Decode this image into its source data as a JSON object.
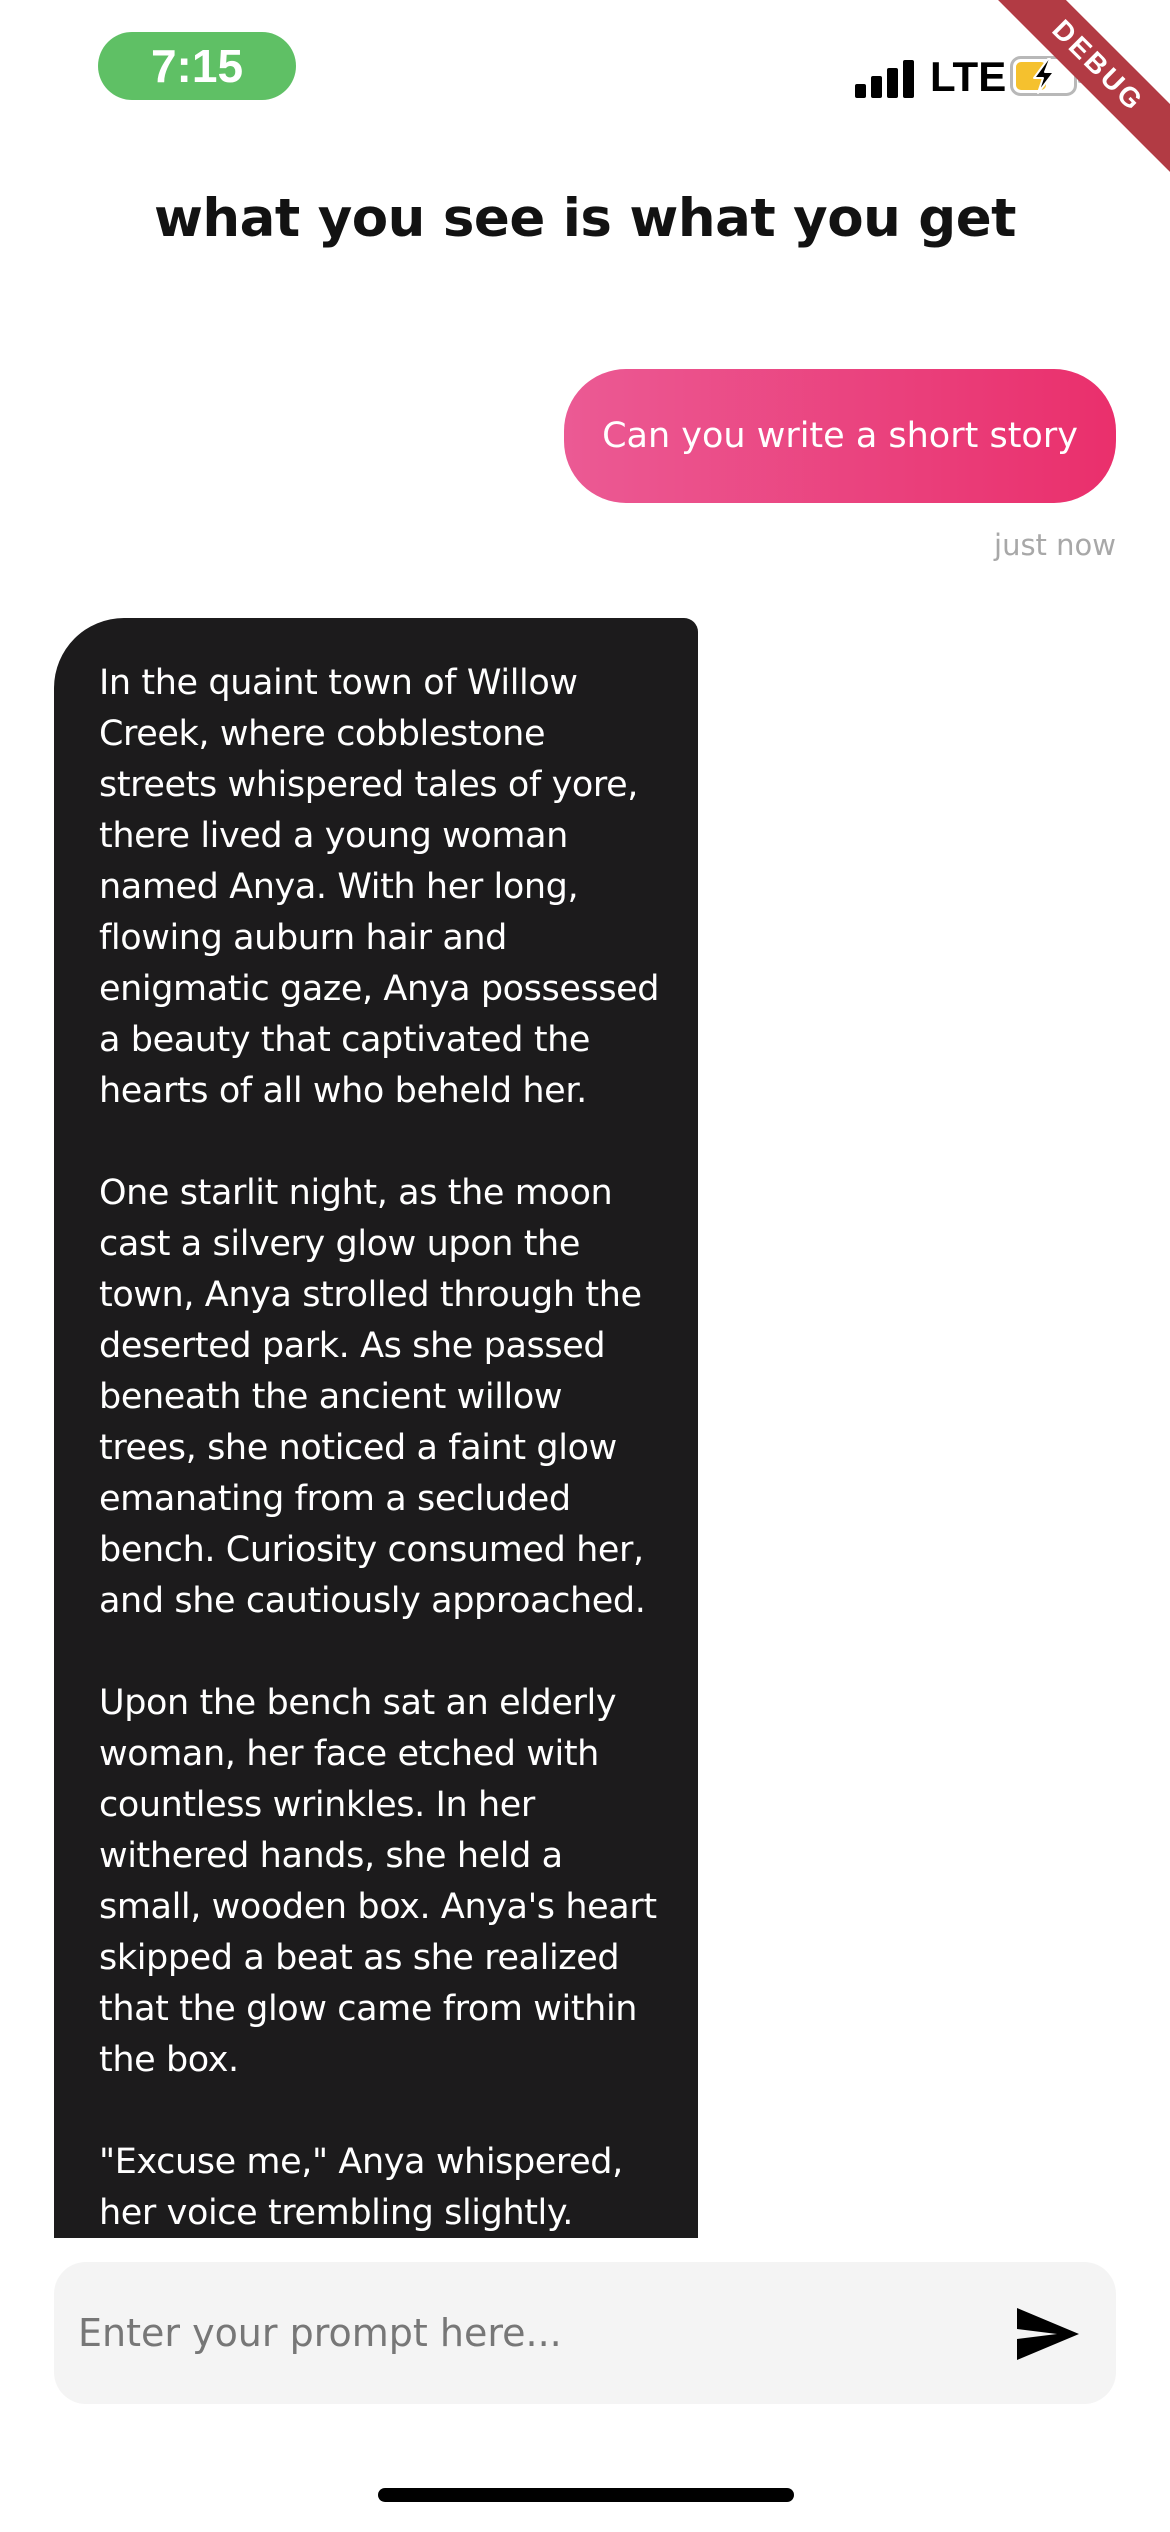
{
  "status_bar": {
    "time": "7:15",
    "network": "LTE",
    "time_pill_color": "#5fc065",
    "icons": [
      "signal-bars-icon",
      "battery-charging-icon"
    ]
  },
  "debug_banner": {
    "label": "DEBUG",
    "color": "#b23b44"
  },
  "header": {
    "title": "what you see is what you get"
  },
  "chat": {
    "messages": [
      {
        "role": "user",
        "text": "Can you write a short story",
        "time": "just now",
        "colors": [
          "#eb5a94",
          "#ea2f6c"
        ]
      },
      {
        "role": "assistant",
        "text": "In the quaint town of Willow Creek, where cobblestone streets whispered tales of yore, there lived a young woman named Anya. With her long, flowing auburn hair and enigmatic gaze, Anya possessed a beauty that captivated the hearts of all who beheld her.\n\nOne starlit night, as the moon cast a silvery glow upon the town, Anya strolled through the deserted park. As she passed beneath the ancient willow trees, she noticed a faint glow emanating from a secluded bench. Curiosity consumed her, and she cautiously approached.\n\nUpon the bench sat an elderly woman, her face etched with countless wrinkles. In her withered hands, she held a small, wooden box. Anya's heart skipped a beat as she realized that the glow came from within the box.\n\n\"Excuse me,\" Anya whispered, her voice trembling slightly.",
        "bubble_color": "#1c1b1c"
      }
    ]
  },
  "composer": {
    "placeholder": "Enter your prompt here...",
    "value": "",
    "send_icon": "send-icon"
  }
}
